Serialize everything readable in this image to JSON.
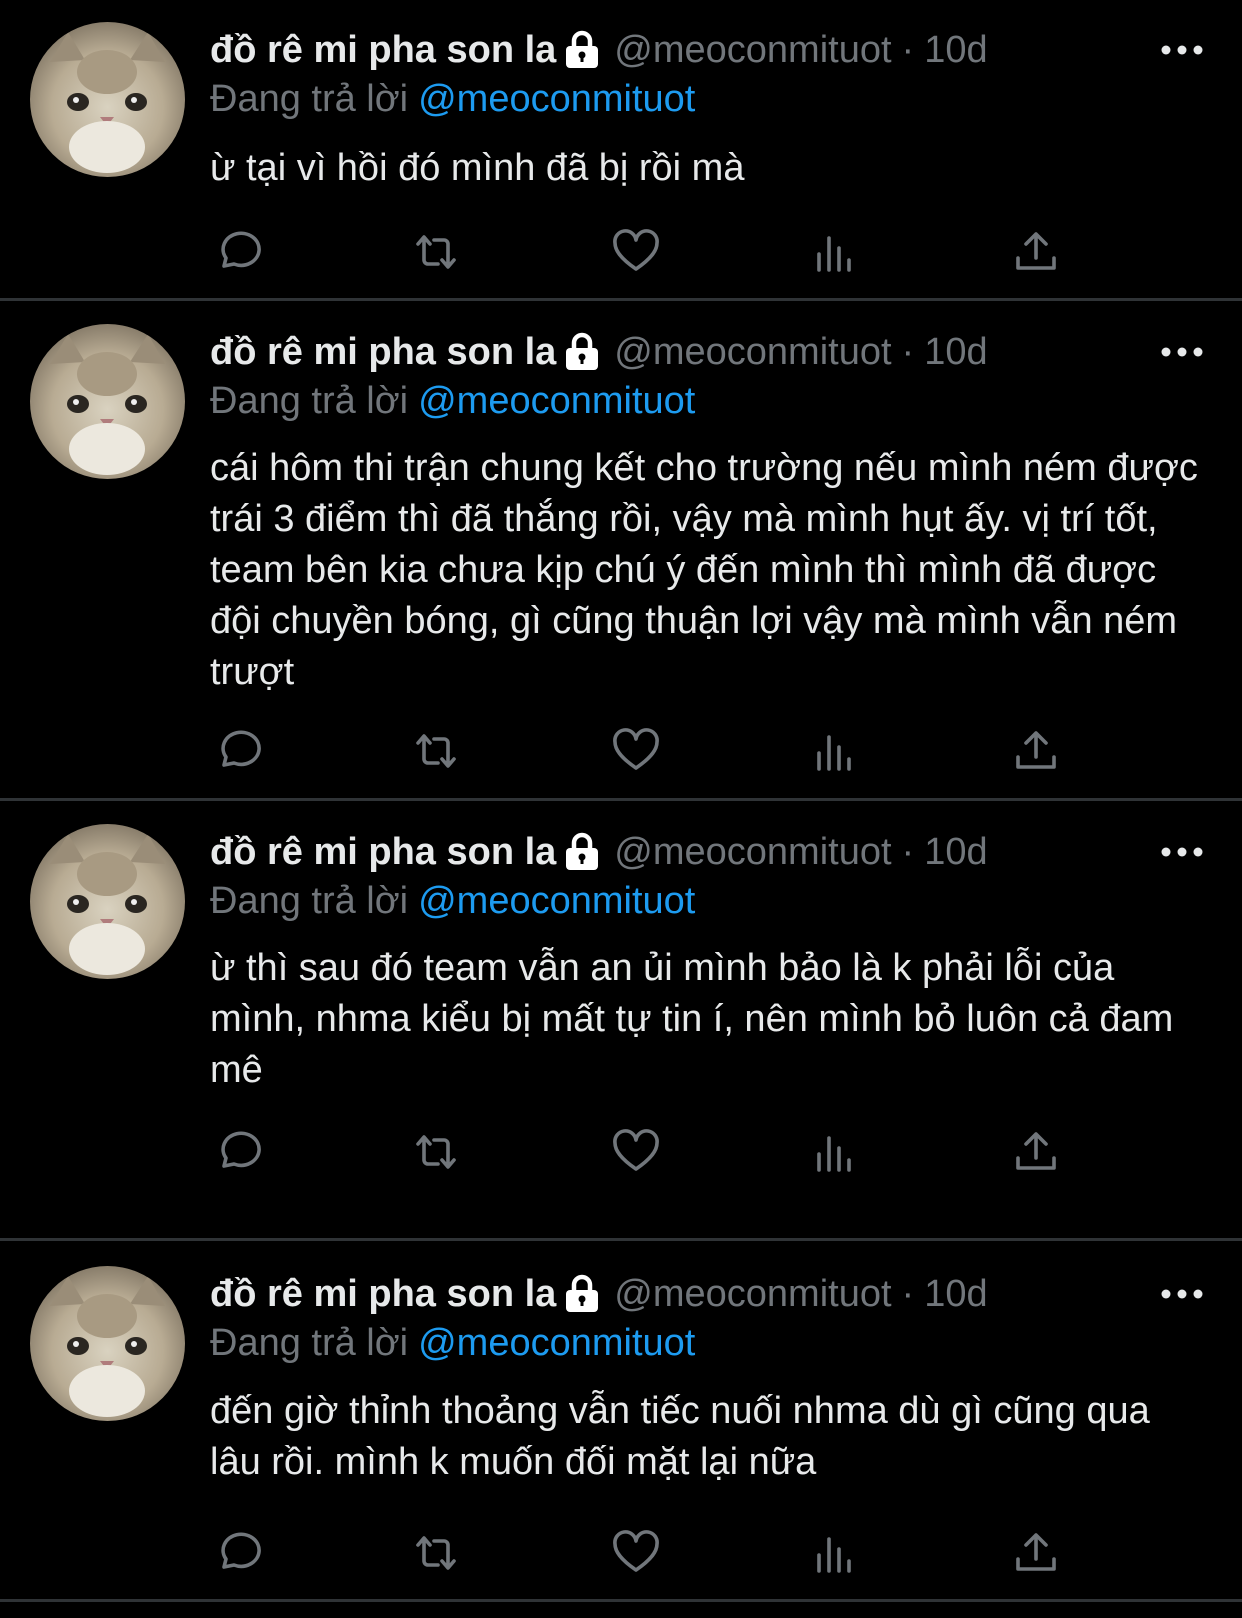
{
  "colors": {
    "background": "#000000",
    "text_primary": "#e7e9ea",
    "text_secondary": "#71767b",
    "mention": "#1d9bf0",
    "divider": "#2f3336"
  },
  "icons": {
    "lock": "lock-icon",
    "more": "more-icon",
    "reply": "reply-icon",
    "retweet": "retweet-icon",
    "like": "heart-icon",
    "views": "views-icon",
    "share": "share-icon"
  },
  "tweets": [
    {
      "display_name": "đồ rê mi pha son la",
      "handle": "@meoconmituot",
      "separator": "·",
      "time": "10d",
      "reply_prefix": "Đang trả lời",
      "reply_to": "@meoconmituot",
      "text": "ừ tại vì hồi đó mình đã bị rồi mà"
    },
    {
      "display_name": "đồ rê mi pha son la",
      "handle": "@meoconmituot",
      "separator": "·",
      "time": "10d",
      "reply_prefix": "Đang trả lời",
      "reply_to": "@meoconmituot",
      "text": "cái hôm thi trận chung kết cho trường nếu mình ném được trái 3 điểm thì đã thắng rồi, vậy mà mình hụt ấy. vị trí tốt, team bên kia chưa kịp chú ý đến mình thì mình đã được đội chuyền bóng, gì cũng thuận lợi vậy mà mình vẫn ném trượt"
    },
    {
      "display_name": "đồ rê mi pha son la",
      "handle": "@meoconmituot",
      "separator": "·",
      "time": "10d",
      "reply_prefix": "Đang trả lời",
      "reply_to": "@meoconmituot",
      "text": "ừ thì sau đó team vẫn an ủi mình bảo là k phải lỗi của mình, nhma kiểu bị mất tự tin í, nên mình bỏ luôn cả đam mê"
    },
    {
      "display_name": "đồ rê mi pha son la",
      "handle": "@meoconmituot",
      "separator": "·",
      "time": "10d",
      "reply_prefix": "Đang trả lời",
      "reply_to": "@meoconmituot",
      "text": "đến giờ thỉnh thoảng vẫn tiếc nuối nhma dù gì cũng qua lâu rồi. mình k muốn đối mặt lại nữa"
    }
  ]
}
